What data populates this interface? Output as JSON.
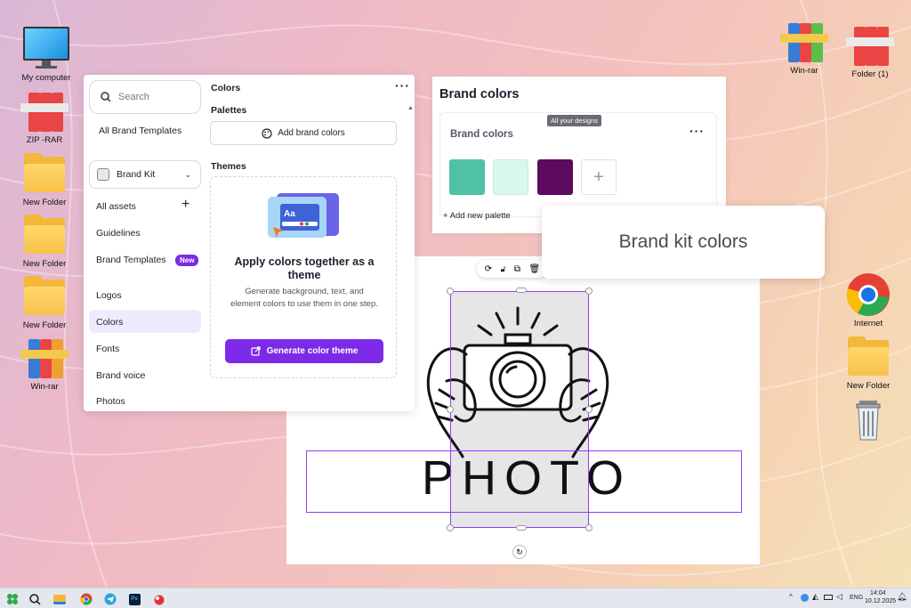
{
  "desktop": {
    "left_icons": [
      {
        "label": "My computer",
        "type": "monitor"
      },
      {
        "label": "ZIP -RAR",
        "type": "rar"
      },
      {
        "label": "New Folder",
        "type": "folder"
      },
      {
        "label": "New Folder",
        "type": "folder"
      },
      {
        "label": "New Folder",
        "type": "folder"
      },
      {
        "label": "Win-rar",
        "type": "winrar"
      }
    ],
    "right_icons": [
      {
        "label": "Win-rar",
        "type": "winrar"
      },
      {
        "label": "Folder (1)",
        "type": "rar"
      },
      {
        "label": "Internet",
        "type": "chrome"
      },
      {
        "label": "New Folder",
        "type": "folder"
      },
      {
        "label": "",
        "type": "trash"
      }
    ]
  },
  "sidebar": {
    "search_placeholder": "Search",
    "all_brand_templates": "All Brand Templates",
    "brand_kit": "Brand Kit",
    "items": [
      {
        "label": "All assets"
      },
      {
        "label": "Guidelines"
      },
      {
        "label": "Brand Templates",
        "badge": "New"
      },
      {
        "label": "Logos"
      },
      {
        "label": "Colors",
        "active": true
      },
      {
        "label": "Fonts"
      },
      {
        "label": "Brand voice"
      },
      {
        "label": "Photos"
      }
    ]
  },
  "colors_panel": {
    "title": "Colors",
    "palettes_heading": "Palettes",
    "add_brand_colors": "Add brand colors",
    "themes_heading": "Themes",
    "theme_title": "Apply colors together as a theme",
    "theme_desc": "Generate background, text, and element colors to use them in one step.",
    "generate_button": "Generate color theme",
    "illustration_text": "Aa"
  },
  "brand_colors": {
    "title": "Brand colors",
    "tooltip": "All your designs",
    "card_title": "Brand colors",
    "swatches": [
      "#4fc1a6",
      "#d9f7ec",
      "#5c0b5c"
    ],
    "add_palette": "Add new palette"
  },
  "callout": {
    "text": "Brand kit colors"
  },
  "canvas": {
    "photo_text": "PHOTO"
  },
  "taskbar": {
    "lang": "ENG",
    "time": "14:04",
    "date": "10.12.2025"
  },
  "colors": {
    "accent": "#7d2ae8",
    "selection": "#8b3dff"
  }
}
